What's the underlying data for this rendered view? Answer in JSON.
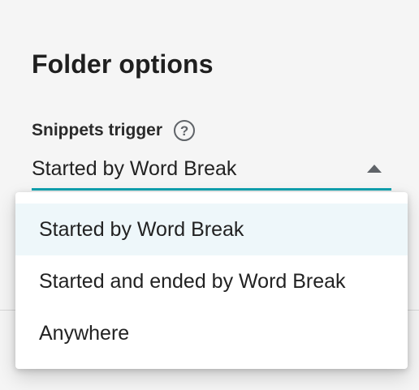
{
  "section": {
    "title": "Folder options"
  },
  "snippets_trigger": {
    "label": "Snippets trigger",
    "help_glyph": "?",
    "selected_value": "Started by Word Break",
    "options": [
      "Started by Word Break",
      "Started and ended by Word Break",
      "Anywhere"
    ]
  },
  "colors": {
    "accent": "#12a3b0",
    "selected_option_background": "#eef7fa"
  },
  "icons": {
    "help": "help-circle-icon",
    "dropdown_arrow": "triangle-up-icon"
  }
}
